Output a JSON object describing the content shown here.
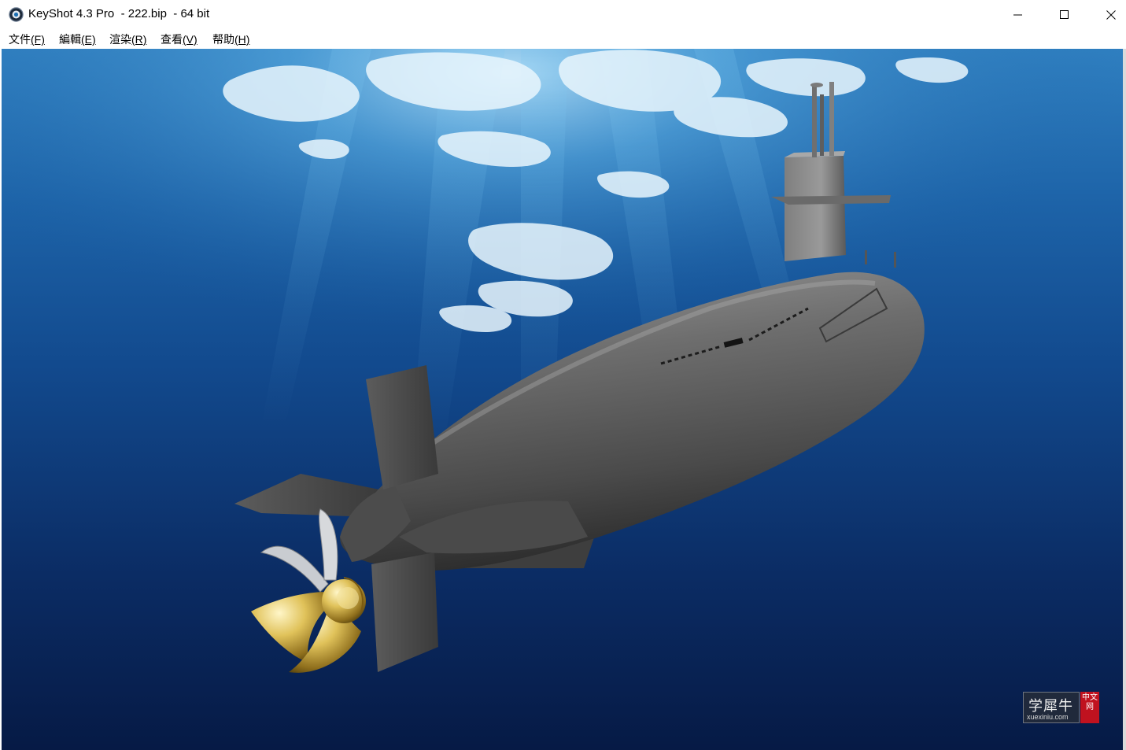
{
  "window": {
    "title": "KeyShot 4.3 Pro  - 222.bip  - 64 bit",
    "app_icon": "keyshot-logo-icon",
    "controls": {
      "minimize": "minimize-icon",
      "maximize": "maximize-icon",
      "close": "close-icon"
    }
  },
  "menubar": {
    "items": [
      {
        "label": "文件",
        "accel": "(F)"
      },
      {
        "label": "編輯",
        "accel": "(E)"
      },
      {
        "label": "渲染",
        "accel": "(R)"
      },
      {
        "label": "查看",
        "accel": "(V)"
      },
      {
        "label": "帮助",
        "accel": "(H)"
      }
    ]
  },
  "watermark": {
    "text": "学犀牛",
    "domain": "xuexiniu.com",
    "tag": "中文网"
  },
  "colors": {
    "water_deep": "#0a2150",
    "water_mid": "#124c94",
    "water_light": "#3f9ad4",
    "hull": "#6a6a6a",
    "propeller": "#d4b44a",
    "watermark_red": "#c0121f"
  }
}
